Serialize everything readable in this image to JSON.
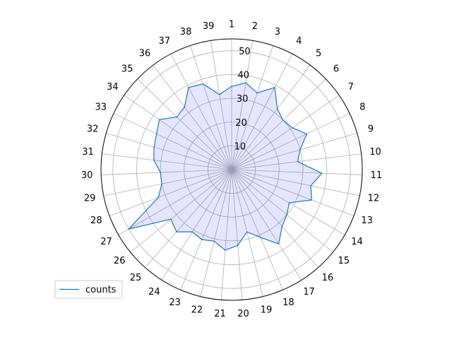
{
  "chart_data": {
    "type": "radar",
    "categories": [
      "1",
      "2",
      "3",
      "4",
      "5",
      "6",
      "7",
      "8",
      "9",
      "10",
      "11",
      "12",
      "13",
      "14",
      "15",
      "16",
      "17",
      "18",
      "19",
      "20",
      "21",
      "22",
      "23",
      "24",
      "25",
      "26",
      "27",
      "28",
      "29",
      "30",
      "31",
      "32",
      "33",
      "34",
      "35",
      "36",
      "37",
      "38",
      "39"
    ],
    "series": [
      {
        "name": "counts",
        "values": [
          35,
          37,
          34,
          39,
          32,
          30,
          31,
          35,
          30,
          28,
          38,
          34,
          36,
          28,
          30,
          32,
          37,
          31,
          27,
          32,
          34,
          31,
          32,
          31,
          35,
          33,
          50,
          33,
          30,
          30,
          33,
          34,
          35,
          37,
          32,
          33,
          39,
          38,
          32
        ]
      }
    ],
    "rlim": [
      0,
      55
    ],
    "r_ticks": [
      10,
      20,
      30,
      40,
      50
    ],
    "grid": true,
    "legend": "lower-left",
    "colors": {
      "line": "#1f77b4",
      "fill": "#0000ff"
    }
  }
}
